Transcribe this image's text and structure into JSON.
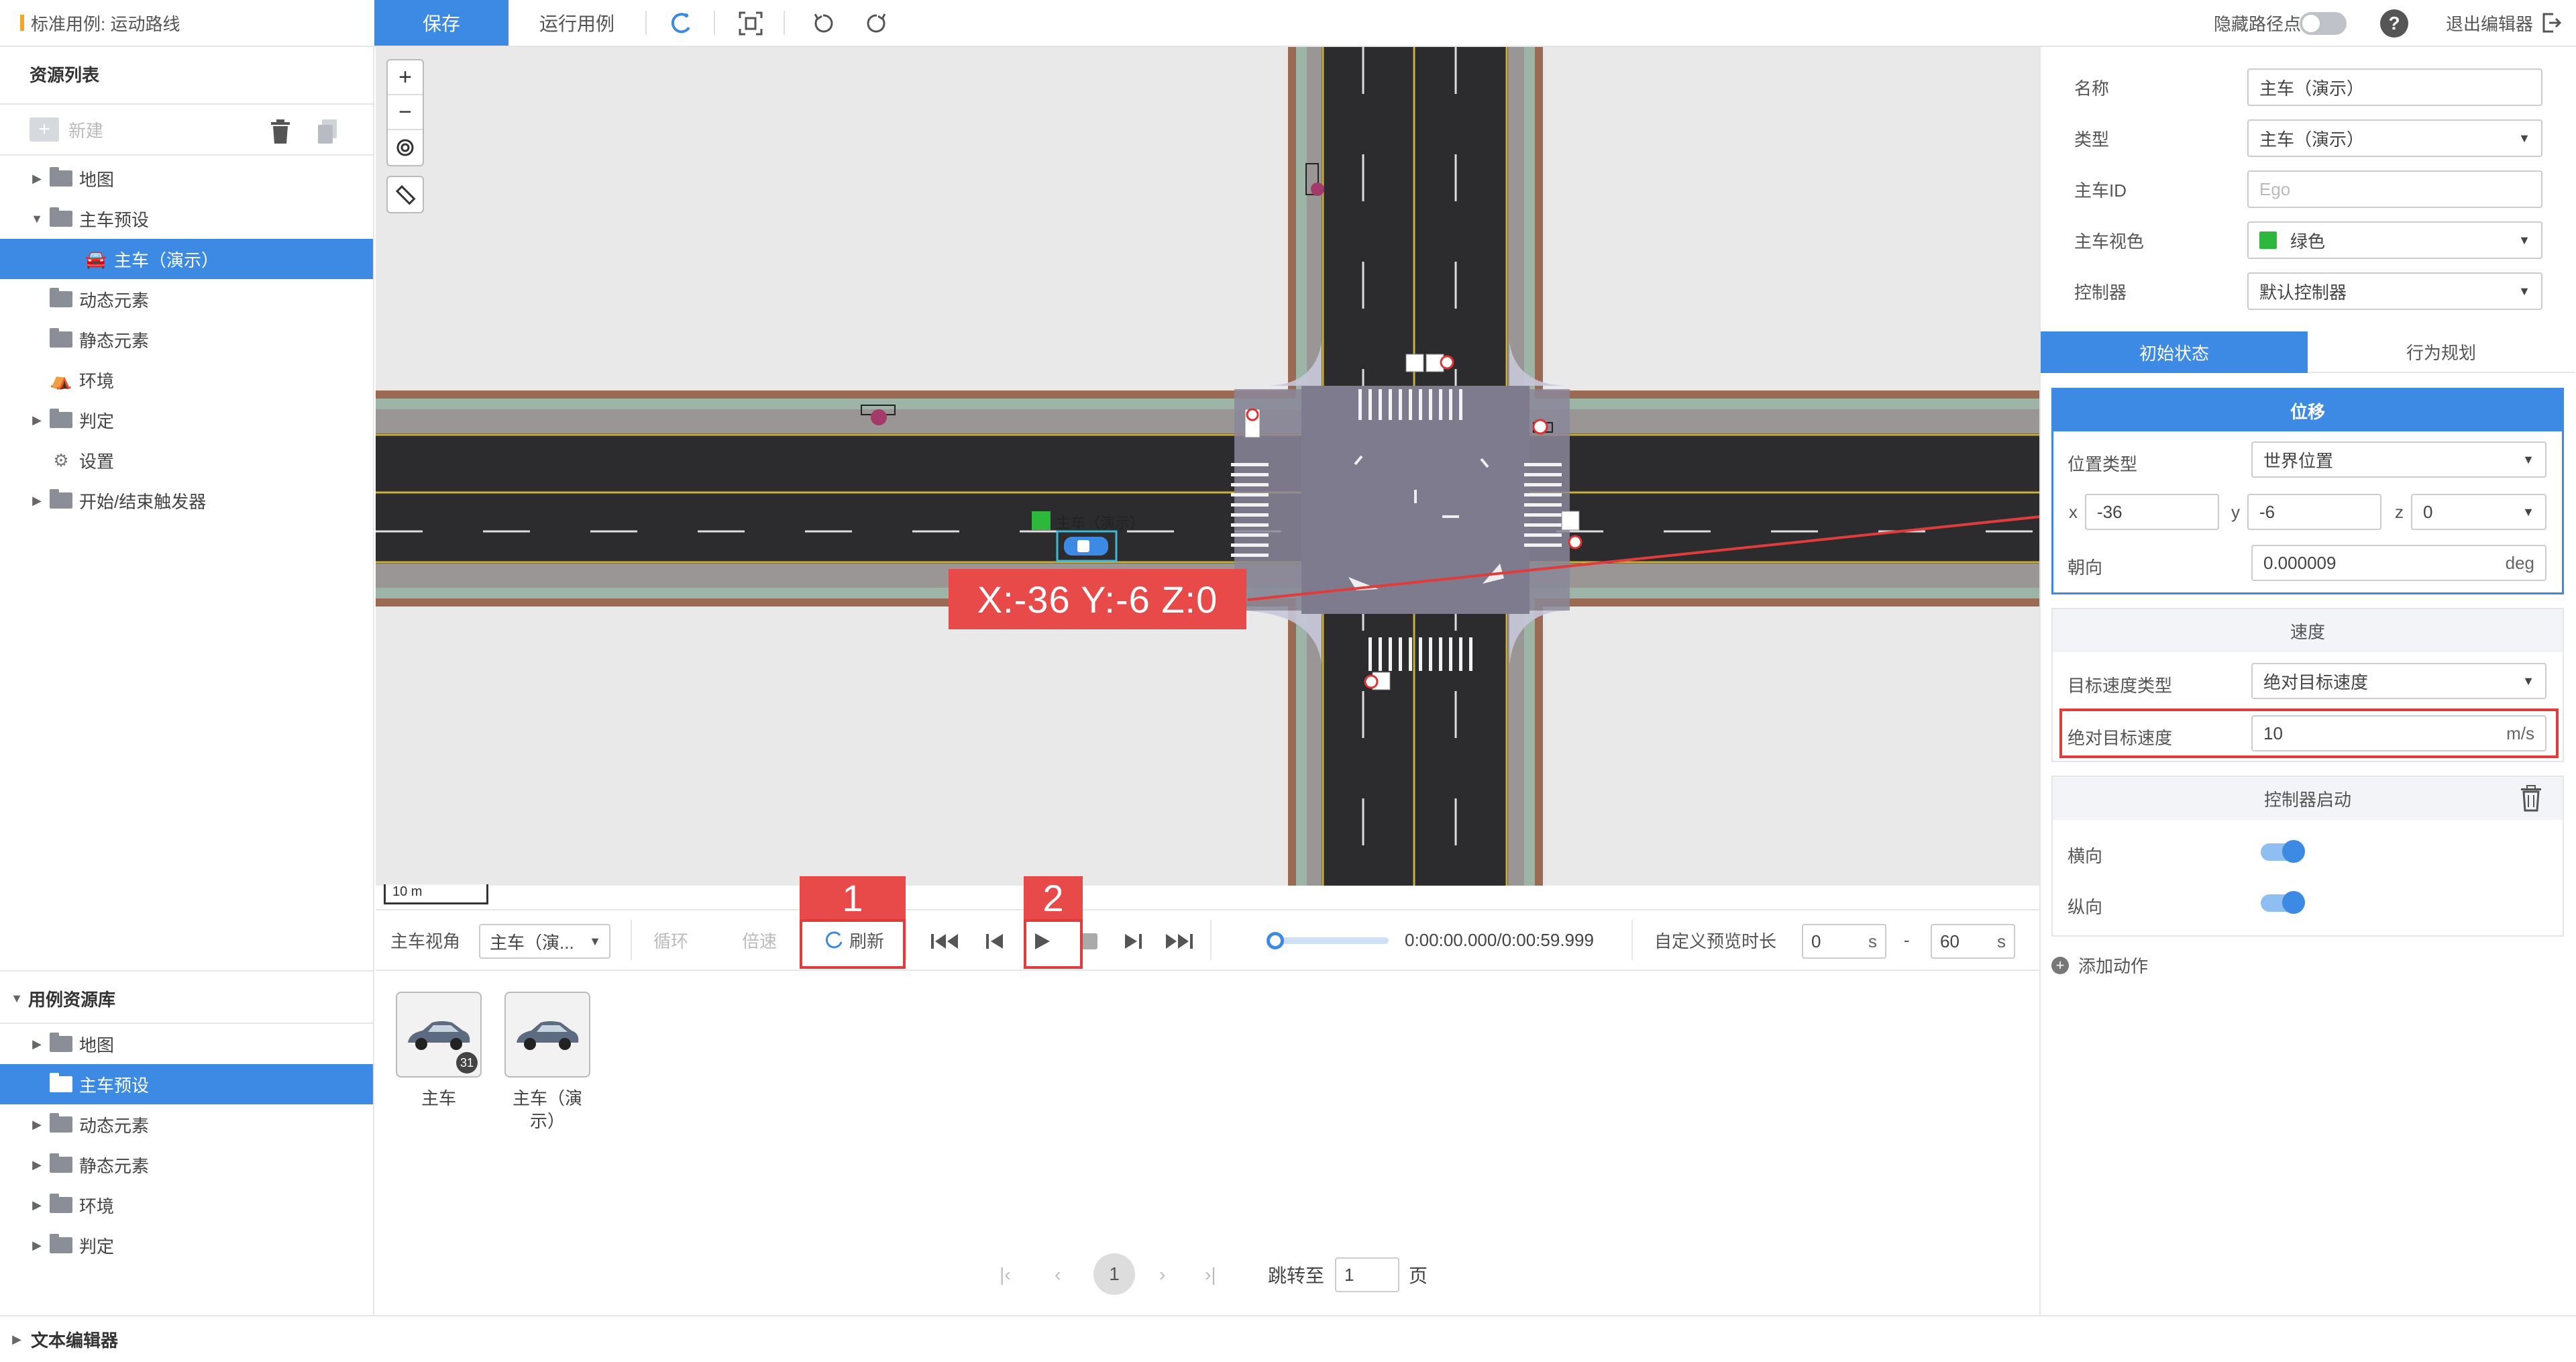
{
  "topbar": {
    "title": "标准用例: 运动路线",
    "save": "保存",
    "run": "运行用例",
    "hide_points": "隐藏路径点",
    "exit": "退出编辑器",
    "help": "?"
  },
  "resources": {
    "title": "资源列表",
    "new": "新建",
    "items": [
      {
        "label": "地图",
        "icon": "folder-icon",
        "caret": "▶"
      },
      {
        "label": "主车预设",
        "icon": "folder-open-icon",
        "caret": "▼"
      },
      {
        "label": "主车（演示）",
        "icon": "car-icon",
        "selected": true
      },
      {
        "label": "动态元素",
        "icon": "folder-icon"
      },
      {
        "label": "静态元素",
        "icon": "folder-icon"
      },
      {
        "label": "环境",
        "icon": "environment-icon"
      },
      {
        "label": "判定",
        "icon": "folder-icon",
        "caret": "▶"
      },
      {
        "label": "设置",
        "icon": "settings-icon"
      },
      {
        "label": "开始/结束触发器",
        "icon": "folder-icon",
        "caret": "▶"
      }
    ]
  },
  "library": {
    "title": "用例资源库",
    "items": [
      {
        "label": "地图"
      },
      {
        "label": "主车预设",
        "selected": true
      },
      {
        "label": "动态元素"
      },
      {
        "label": "静态元素"
      },
      {
        "label": "环境"
      },
      {
        "label": "判定"
      }
    ]
  },
  "text_editor": "文本编辑器",
  "map": {
    "zoom_in": "+",
    "zoom_out": "−",
    "scale": "10 m",
    "vehicle_label": "主车（演示）",
    "coord_text": "X:-36  Y:-6  Z:0"
  },
  "playback": {
    "view_label": "主车视角",
    "view_value": "主车（演...",
    "loop": "循环",
    "speed": "倍速",
    "refresh": "刷新",
    "time": "0:00:00.000/0:00:59.999",
    "custom_preview": "自定义预览时长",
    "start": "0",
    "end": "60",
    "unit": "s",
    "dash": "-",
    "marker1": "1",
    "marker2": "2",
    "progress": 0
  },
  "assets": [
    {
      "name": "主车",
      "badge": "31"
    },
    {
      "name": "主车（演示）"
    }
  ],
  "pagination": {
    "current": "1",
    "jump_label": "跳转至",
    "jump_value": "1",
    "page_label": "页"
  },
  "props": {
    "name_label": "名称",
    "name_value": "主车（演示）",
    "type_label": "类型",
    "type_value": "主车（演示）",
    "id_label": "主车ID",
    "id_placeholder": "Ego",
    "color_label": "主车视色",
    "color_value": "绿色",
    "color_hex": "#2db83d",
    "controller_label": "控制器",
    "controller_value": "默认控制器"
  },
  "tabs": {
    "initial": "初始状态",
    "behavior": "行为规划"
  },
  "position": {
    "title": "位移",
    "type_label": "位置类型",
    "type_value": "世界位置",
    "x_label": "x",
    "x_value": "-36",
    "y_label": "y",
    "y_value": "-6",
    "z_label": "z",
    "z_value": "0",
    "heading_label": "朝向",
    "heading_value": "0.000009",
    "heading_unit": "deg"
  },
  "speed": {
    "title": "速度",
    "type_label": "目标速度类型",
    "type_value": "绝对目标速度",
    "abs_label": "绝对目标速度",
    "abs_value": "10",
    "abs_unit": "m/s"
  },
  "controller_start": {
    "title": "控制器启动",
    "lateral": "横向",
    "longitudinal": "纵向",
    "lateral_on": true,
    "longitudinal_on": true
  },
  "add_action": "添加动作",
  "colors": {
    "accent": "#3d8ae5",
    "annotation": "#e84a4a"
  }
}
